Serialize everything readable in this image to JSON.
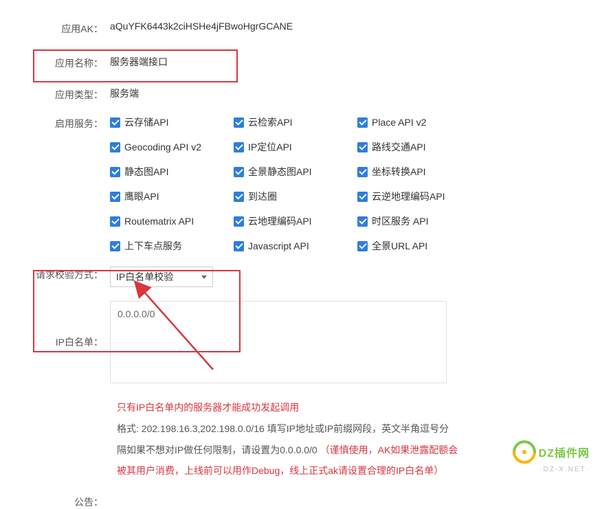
{
  "labels": {
    "app_ak": "应用AK：",
    "app_name": "应用名称：",
    "app_type": "应用类型：",
    "enable_services": "启用服务：",
    "verify_mode": "请求校验方式：",
    "ip_whitelist": "IP白名单：",
    "announcement": "公告："
  },
  "values": {
    "app_ak": "aQuYFK6443k2ciHSHe4jFBwoHgrGCANE",
    "app_name": "服务器端接口",
    "app_type": "服务端",
    "verify_mode_selected": "IP白名单校验",
    "ip_whitelist": "0.0.0.0/0"
  },
  "services": [
    {
      "label": "云存储API"
    },
    {
      "label": "云检索API"
    },
    {
      "label": "Place API v2"
    },
    {
      "label": "Geocoding API v2"
    },
    {
      "label": "IP定位API"
    },
    {
      "label": "路线交通API"
    },
    {
      "label": "静态图API"
    },
    {
      "label": "全景静态图API"
    },
    {
      "label": "坐标转换API"
    },
    {
      "label": "鹰眼API"
    },
    {
      "label": "到达圈"
    },
    {
      "label": "云逆地理编码API"
    },
    {
      "label": "Routematrix API"
    },
    {
      "label": "云地理编码API"
    },
    {
      "label": "时区服务 API"
    },
    {
      "label": "上下车点服务"
    },
    {
      "label": "Javascript API"
    },
    {
      "label": "全景URL API"
    }
  ],
  "notes": {
    "line1": "只有IP白名单内的服务器才能成功发起调用",
    "line2a": "格式: 202.198.16.3,202.198.0.0/16 填写IP地址或IP前缀网段，英文半角逗号分",
    "line2b": "隔如果不想对IP做任何限制，请设置为0.0.0.0/0 ",
    "line2c": "（谨慎使用，AK如果泄露配额会",
    "line2d": "被其用户消费，上线前可以用作Debug，线上正式ak请设置合理的IP白名单）"
  },
  "watermark": {
    "text": "DZ插件网",
    "sub": "·DZ-X.NET·"
  }
}
